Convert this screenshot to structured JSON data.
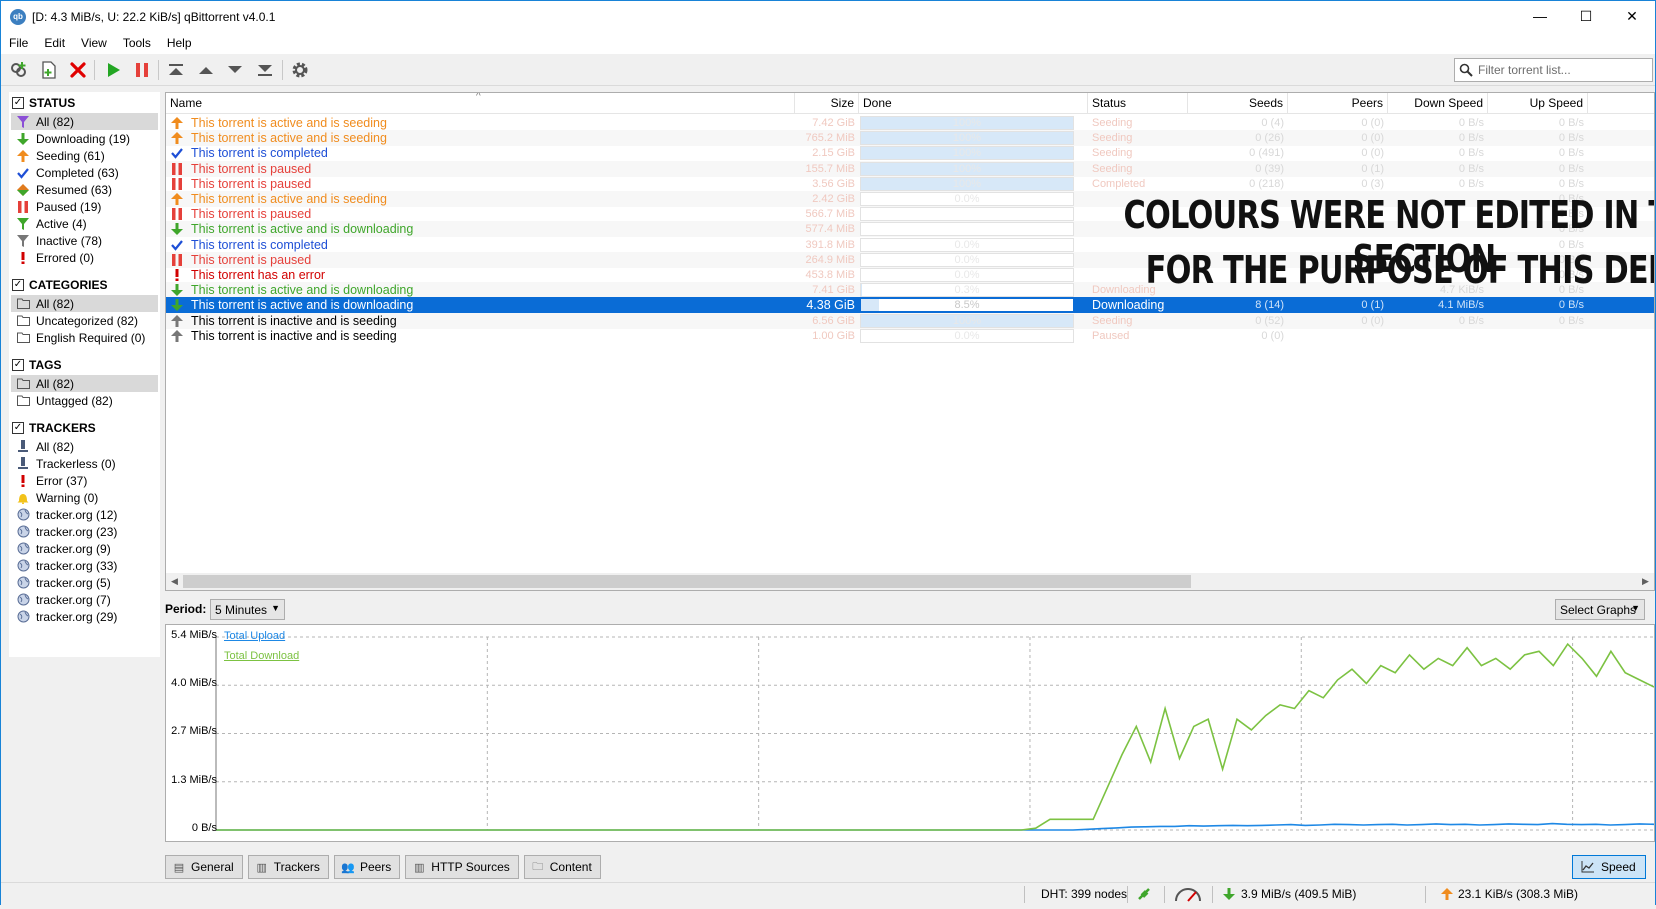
{
  "window": {
    "title": "[D: 4.3 MiB/s, U: 22.2 KiB/s] qBittorrent v4.0.1",
    "app_icon": "qb",
    "minimize_glyph": "—",
    "maximize_glyph": "☐",
    "close_glyph": "✕"
  },
  "menu": [
    "File",
    "Edit",
    "View",
    "Tools",
    "Help"
  ],
  "toolbar": {
    "filter_placeholder": "Filter torrent list..."
  },
  "sidebar": {
    "status": {
      "title": "STATUS",
      "items": [
        {
          "label": "All (82)",
          "icon": "filter-icon"
        },
        {
          "label": "Downloading (19)",
          "icon": "download-arrow-icon"
        },
        {
          "label": "Seeding (61)",
          "icon": "upload-arrow-icon"
        },
        {
          "label": "Completed (63)",
          "icon": "checkmark-icon"
        },
        {
          "label": "Resumed (63)",
          "icon": "diamond-icon"
        },
        {
          "label": "Paused (19)",
          "icon": "pause-icon"
        },
        {
          "label": "Active (4)",
          "icon": "filter-icon"
        },
        {
          "label": "Inactive (78)",
          "icon": "filter-icon"
        },
        {
          "label": "Errored (0)",
          "icon": "exclamation-icon"
        }
      ]
    },
    "categories": {
      "title": "CATEGORIES",
      "items": [
        {
          "label": "All (82)"
        },
        {
          "label": "Uncategorized (82)"
        },
        {
          "label": "English Required (0)"
        }
      ]
    },
    "tags": {
      "title": "TAGS",
      "items": [
        {
          "label": "All (82)"
        },
        {
          "label": "Untagged (82)"
        }
      ]
    },
    "trackers": {
      "title": "TRACKERS",
      "items": [
        {
          "label": "All (82)",
          "icon": "server-icon"
        },
        {
          "label": "Trackerless (0)",
          "icon": "server-icon"
        },
        {
          "label": "Error (37)",
          "icon": "exclamation-icon"
        },
        {
          "label": "Warning (0)",
          "icon": "bell-icon"
        },
        {
          "label": "tracker.org (12)",
          "icon": "globe-icon"
        },
        {
          "label": "tracker.org (23)",
          "icon": "globe-icon"
        },
        {
          "label": "tracker.org (9)",
          "icon": "globe-icon"
        },
        {
          "label": "tracker.org (33)",
          "icon": "globe-icon"
        },
        {
          "label": "tracker.org (5)",
          "icon": "globe-icon"
        },
        {
          "label": "tracker.org (7)",
          "icon": "globe-icon"
        },
        {
          "label": "tracker.org (29)",
          "icon": "globe-icon"
        }
      ]
    }
  },
  "torrents": {
    "columns": [
      "Name",
      "Size",
      "Done",
      "Status",
      "Seeds",
      "Peers",
      "Down Speed",
      "Up Speed"
    ],
    "colors": {
      "seeding": "#f08c1e",
      "completed": "#1e4fd6",
      "paused": "#e5403a",
      "downloading": "#3fa62b",
      "error": "#d10000",
      "inactive": "#000000"
    },
    "rows": [
      {
        "name": "This torrent is active and is seeding",
        "state": "seeding",
        "icon": "upload-arrow-icon",
        "size": "7.42 GiB",
        "done": "100%",
        "progress": 1.0,
        "status": "Seeding",
        "seeds": "0 (4)",
        "peers": "0 (0)",
        "down": "0 B/s",
        "up": "0 B/s"
      },
      {
        "name": "This torrent is active and is seeding",
        "state": "seeding",
        "icon": "upload-arrow-icon",
        "size": "765.2 MiB",
        "done": "100%",
        "progress": 1.0,
        "status": "Seeding",
        "seeds": "0 (26)",
        "peers": "0 (0)",
        "down": "0 B/s",
        "up": "0 B/s"
      },
      {
        "name": "This torrent is completed",
        "state": "completed",
        "icon": "checkmark-icon",
        "size": "2.15 GiB",
        "done": "100%",
        "progress": 1.0,
        "status": "Seeding",
        "seeds": "0 (491)",
        "peers": "0 (0)",
        "down": "0 B/s",
        "up": "0 B/s"
      },
      {
        "name": "This torrent is paused",
        "state": "paused",
        "icon": "pause-icon",
        "size": "155.7 MiB",
        "done": "100%",
        "progress": 1.0,
        "status": "Seeding",
        "seeds": "0 (39)",
        "peers": "0 (1)",
        "down": "0 B/s",
        "up": "0 B/s"
      },
      {
        "name": "This torrent is paused",
        "state": "paused",
        "icon": "pause-icon",
        "size": "3.56 GiB",
        "done": "100%",
        "progress": 1.0,
        "status": "Completed",
        "seeds": "0 (218)",
        "peers": "0 (3)",
        "down": "0 B/s",
        "up": "0 B/s"
      },
      {
        "name": "This torrent is active and is seeding",
        "state": "seeding",
        "icon": "upload-arrow-icon",
        "size": "2.42 GiB",
        "done": "0.0%",
        "progress": 0.0,
        "status": "",
        "seeds": "",
        "peers": "",
        "down": "",
        "up": "0 B/s"
      },
      {
        "name": "This torrent is paused",
        "state": "paused",
        "icon": "pause-icon",
        "size": "566.7 MiB",
        "done": "",
        "progress": 0.0,
        "status": "",
        "seeds": "",
        "peers": "",
        "down": "",
        "up": "0 B/s"
      },
      {
        "name": "This torrent is active and is downloading",
        "state": "downloading",
        "icon": "download-arrow-icon",
        "size": "577.4 MiB",
        "done": "",
        "progress": 0.0,
        "status": "",
        "seeds": "",
        "peers": "",
        "down": "",
        "up": "0 B/s"
      },
      {
        "name": "This torrent is completed",
        "state": "completed",
        "icon": "checkmark-icon",
        "size": "391.8 MiB",
        "done": "0.0%",
        "progress": 0.0,
        "status": "",
        "seeds": "",
        "peers": "",
        "down": "",
        "up": "0 B/s"
      },
      {
        "name": "This torrent is paused",
        "state": "paused",
        "icon": "pause-icon",
        "size": "264.9 MiB",
        "done": "0.0%",
        "progress": 0.0,
        "status": "",
        "seeds": "",
        "peers": "",
        "down": "",
        "up": "0 B/s"
      },
      {
        "name": "This torrent has an error",
        "state": "error",
        "icon": "exclamation-icon",
        "size": "453.8 MiB",
        "done": "0.0%",
        "progress": 0.0,
        "status": "",
        "seeds": "",
        "peers": "",
        "down": "",
        "up": "0 B/s"
      },
      {
        "name": "This torrent is active and is downloading",
        "state": "downloading",
        "icon": "download-arrow-icon",
        "size": "7.41 GiB",
        "done": "0.3%",
        "progress": 0.003,
        "status": "Downloading",
        "seeds": "",
        "peers": "",
        "down": "4.7 KiB/s",
        "up": "0 B/s"
      },
      {
        "name": "This torrent is active and is downloading",
        "state": "downloading",
        "icon": "download-arrow-icon",
        "size": "4.38 GiB",
        "done": "8.5%",
        "progress": 0.085,
        "status": "Downloading",
        "seeds": "8 (14)",
        "peers": "0 (1)",
        "down": "4.1 MiB/s",
        "up": "0 B/s",
        "selected": true
      },
      {
        "name": "This torrent is inactive and is seeding",
        "state": "inactive",
        "icon": "upload-arrow-gray-icon",
        "size": "6.56 GiB",
        "done": "100%",
        "progress": 1.0,
        "status": "Seeding",
        "seeds": "0 (52)",
        "peers": "0 (0)",
        "down": "0 B/s",
        "up": "0 B/s"
      },
      {
        "name": "This torrent is inactive and is seeding",
        "state": "inactive",
        "icon": "upload-arrow-gray-icon",
        "size": "1.00 GiB",
        "done": "0.0%",
        "progress": 0.0,
        "status": "Paused",
        "seeds": "0 (0)",
        "peers": "",
        "down": "",
        "up": ""
      }
    ]
  },
  "overlay": {
    "line1": "COLOURS WERE NOT EDITED IN THIS SECTION",
    "line2": "FOR THE PURPOSE OF THIS DEMO"
  },
  "graph_controls": {
    "period_label": "Period:",
    "period_value": "5 Minutes",
    "select_graphs": "Select Graphs"
  },
  "chart_data": {
    "type": "line",
    "y_ticks": [
      "5.4 MiB/s",
      "4.0 MiB/s",
      "2.7 MiB/s",
      "1.3 MiB/s",
      "0 B/s"
    ],
    "ylim": [
      0,
      5.4
    ],
    "series": [
      {
        "name": "Total Upload",
        "color": "#1e88e5",
        "values": [
          0,
          0,
          0,
          0,
          0,
          0,
          0,
          0,
          0,
          0,
          0,
          0,
          0,
          0,
          0,
          0,
          0,
          0,
          0,
          0,
          0,
          0,
          0,
          0,
          0,
          0,
          0,
          0,
          0,
          0,
          0,
          0,
          0,
          0,
          0,
          0,
          0,
          0,
          0,
          0,
          0,
          0,
          0,
          0,
          0,
          0,
          0,
          0,
          0,
          0,
          0,
          0,
          0,
          0,
          0,
          0,
          0,
          0,
          0,
          0,
          0.02,
          0.04,
          0.06,
          0.08,
          0.09,
          0.1,
          0.1,
          0.12,
          0.11,
          0.12,
          0.13,
          0.12,
          0.13,
          0.14,
          0.15,
          0.13,
          0.14,
          0.16,
          0.15,
          0.14,
          0.15,
          0.16,
          0.14,
          0.15,
          0.17,
          0.15,
          0.16,
          0.14,
          0.15,
          0.17,
          0.16,
          0.15,
          0.18,
          0.16,
          0.15,
          0.16,
          0.14,
          0.15,
          0.17,
          0.16
        ]
      },
      {
        "name": "Total Download",
        "color": "#7cc242",
        "values": [
          0,
          0,
          0,
          0,
          0,
          0,
          0,
          0,
          0,
          0,
          0,
          0,
          0,
          0,
          0,
          0,
          0,
          0,
          0,
          0,
          0,
          0,
          0,
          0,
          0,
          0,
          0,
          0,
          0,
          0,
          0,
          0,
          0,
          0,
          0,
          0,
          0,
          0,
          0,
          0,
          0,
          0,
          0,
          0,
          0,
          0,
          0,
          0,
          0,
          0,
          0,
          0,
          0,
          0,
          0,
          0,
          0,
          0.05,
          0.3,
          0.3,
          0.3,
          0.3,
          1.2,
          2.1,
          2.9,
          1.9,
          3.4,
          2.0,
          2.9,
          3.1,
          1.7,
          3.1,
          2.8,
          3.2,
          3.5,
          3.4,
          3.9,
          3.7,
          4.2,
          4.5,
          4.1,
          4.6,
          4.4,
          4.9,
          4.5,
          4.8,
          4.6,
          5.1,
          4.6,
          4.8,
          4.5,
          4.9,
          5.0,
          4.6,
          5.2,
          4.8,
          4.3,
          5.0,
          4.4,
          4.2,
          4.0
        ]
      }
    ]
  },
  "bottom_tabs": [
    "General",
    "Trackers",
    "Peers",
    "HTTP Sources",
    "Content"
  ],
  "speed_tab": "Speed",
  "statusbar": {
    "dht": "DHT: 399 nodes",
    "download": "3.9 MiB/s (409.5 MiB)",
    "upload": "23.1 KiB/s (308.3 MiB)"
  }
}
